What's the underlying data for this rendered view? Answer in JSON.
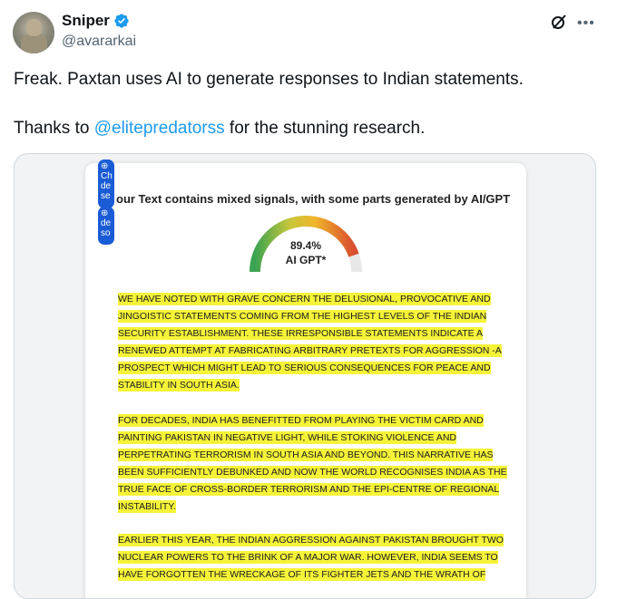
{
  "author": {
    "name": "Sniper",
    "handle": "@avararkai"
  },
  "tweet": {
    "line1": "Freak. Paxtan uses AI to generate responses to Indian statements.",
    "line2_before": "Thanks to ",
    "mention": "@elitepredatorss",
    "line2_after": " for the stunning research."
  },
  "media": {
    "chip1_text": "Ch de se",
    "chip2_text": "de so",
    "heading": "our Text contains mixed signals, with some parts generated by AI/GPT",
    "gauge_value": "89.4%",
    "gauge_label": "AI GPT*",
    "gauge_fraction": 0.894,
    "paragraphs": [
      "We have noted with grave concern the delusional, provocative and jingoistic statements coming from the highest levels of the Indian security establishment. These irresponsible statements indicate a renewed attempt at fabricating arbitrary pretexts for aggression -a prospect which might lead to serious consequences for peace and stability in South Asia.",
      "For decades, India has benefitted from playing the victim card and painting Pakistan in negative light, while stoking violence and perpetrating terrorism in South Asia and beyond. This narrative has been sufficiently debunked and now the world recognises India as the true face of cross-border terrorism and the epi-centre of regional instability.",
      "Earlier this year, the Indian aggression against Pakistan brought two nuclear powers to the brink of a major war. However, India seems to have forgotten the wreckage of its fighter jets and the wrath of"
    ],
    "highlight_color": "#f5f338"
  },
  "colors": {
    "accent": "#1d9bf0",
    "text": "#0f1419",
    "secondary": "#536471"
  }
}
